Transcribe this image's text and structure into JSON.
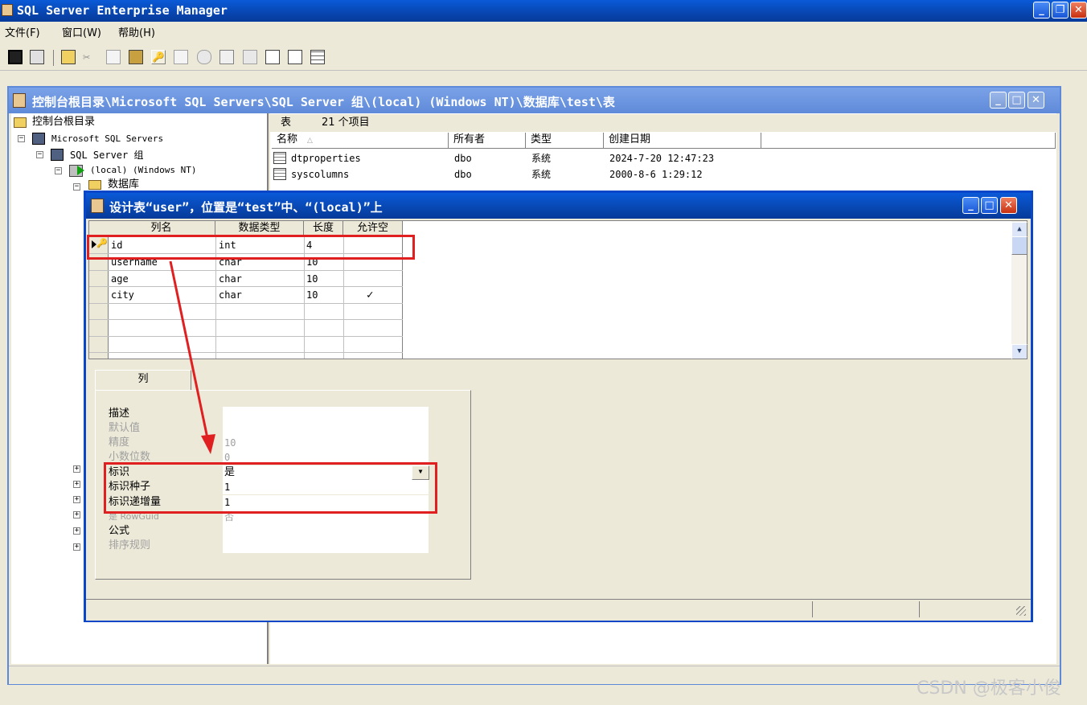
{
  "app": {
    "title": "SQL Server Enterprise Manager",
    "menu": [
      "文件(F)",
      "窗口(W)",
      "帮助(H)"
    ]
  },
  "console": {
    "title": "控制台根目录\\Microsoft SQL Servers\\SQL Server 组\\(local) (Windows NT)\\数据库\\test\\表",
    "tree": {
      "root": "控制台根目录",
      "servers": "Microsoft SQL Servers",
      "group": "SQL Server 组",
      "local": "(local) (Windows NT)",
      "databases": "数据库"
    },
    "list_header": {
      "label": "表",
      "count": "21 个项目"
    },
    "columns": [
      "名称",
      "所有者",
      "类型",
      "创建日期"
    ],
    "rows": [
      {
        "name": "dtproperties",
        "owner": "dbo",
        "type": "系统",
        "created": "2024-7-20 12:47:23"
      },
      {
        "name": "syscolumns",
        "owner": "dbo",
        "type": "系统",
        "created": "2000-8-6 1:29:12"
      }
    ]
  },
  "designer": {
    "title": "设计表“user”，位置是“test”中、“(local)”上",
    "columns": [
      "列名",
      "数据类型",
      "长度",
      "允许空"
    ],
    "rows": [
      {
        "name": "id",
        "type": "int",
        "length": "4",
        "nullable": ""
      },
      {
        "name": "username",
        "type": "char",
        "length": "10",
        "nullable": ""
      },
      {
        "name": "age",
        "type": "char",
        "length": "10",
        "nullable": ""
      },
      {
        "name": "city",
        "type": "char",
        "length": "10",
        "nullable": "✓"
      }
    ],
    "tab": "列",
    "props": {
      "desc": {
        "label": "描述",
        "value": ""
      },
      "default": {
        "label": "默认值",
        "value": ""
      },
      "precision": {
        "label": "精度",
        "value": "10"
      },
      "scale": {
        "label": "小数位数",
        "value": "0"
      },
      "identity": {
        "label": "标识",
        "value": "是"
      },
      "seed": {
        "label": "标识种子",
        "value": "1"
      },
      "increment": {
        "label": "标识递增量",
        "value": "1"
      },
      "rowguid": {
        "label": "是 RowGuid",
        "value": "否"
      },
      "formula": {
        "label": "公式",
        "value": ""
      },
      "collation": {
        "label": "排序规则",
        "value": ""
      }
    }
  },
  "watermark": "CSDN @极客小俊",
  "colors": {
    "xp_blue": "#0a5ad8",
    "highlight_red": "#e02020",
    "face": "#ece9d8"
  }
}
